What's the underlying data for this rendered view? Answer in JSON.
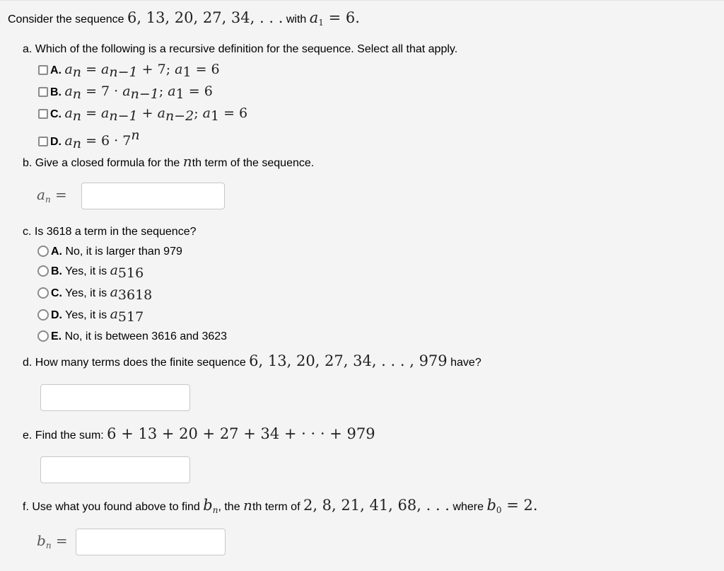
{
  "intro": {
    "prefix": "Consider the sequence ",
    "sequence": "6, 13, 20, 27, 34, . . .",
    "with_label": " with ",
    "first_term": {
      "var": "a",
      "sub": "1",
      "rest": " = 6."
    }
  },
  "part_a": {
    "question": "a. Which of the following is a recursive definition for the sequence. Select all that apply.",
    "options": [
      {
        "label": "A.",
        "formula": {
          "lhs": "a",
          "lhs_sub": "n",
          "p1": " = ",
          "v1": "a",
          "v1_sub": "n−1",
          "p2": " + 7; ",
          "v2": "a",
          "v2_sub": "1",
          "p3": " = 6"
        },
        "checked": false
      },
      {
        "label": "B.",
        "formula": {
          "lhs": "a",
          "lhs_sub": "n",
          "p1": " = 7 · ",
          "v1": "a",
          "v1_sub": "n−1",
          "p2": "; ",
          "v2": "a",
          "v2_sub": "1",
          "p3": " = 6"
        },
        "checked": false
      },
      {
        "label": "C.",
        "formula": {
          "lhs": "a",
          "lhs_sub": "n",
          "p1": " = ",
          "v1": "a",
          "v1_sub": "n−1",
          "p2": " + ",
          "v2": "a",
          "v2_sub": "n−2",
          "p3": "; ",
          "v3": "a",
          "v3_sub": "1",
          "p4": " = 6"
        },
        "checked": false
      },
      {
        "label": "D.",
        "formula": {
          "lhs": "a",
          "lhs_sub": "n",
          "p1": " = 6 · 7",
          "sup": "n"
        },
        "checked": false
      }
    ]
  },
  "part_b": {
    "question_pre": "b. Give a closed formula for the ",
    "question_var": "n",
    "question_post": "th term of the sequence.",
    "answer_lhs": "a",
    "answer_lhs_sub": "n",
    "answer_eq": " =",
    "answer_value": ""
  },
  "part_c": {
    "question": "c. Is 3618 a term in the sequence?",
    "options": [
      {
        "label": "A.",
        "text": " No, it is larger than 979",
        "var": "",
        "sub": "",
        "selected": false
      },
      {
        "label": "B.",
        "text": " Yes, it is ",
        "var": "a",
        "sub": "516",
        "selected": false
      },
      {
        "label": "C.",
        "text": " Yes, it is ",
        "var": "a",
        "sub": "3618",
        "selected": false
      },
      {
        "label": "D.",
        "text": " Yes, it is ",
        "var": "a",
        "sub": "517",
        "selected": false
      },
      {
        "label": "E.",
        "text": " No, it is between 3616 and 3623",
        "var": "",
        "sub": "",
        "selected": false
      }
    ]
  },
  "part_d": {
    "question_pre": "d. How many terms does the finite sequence ",
    "sequence": "6, 13, 20, 27, 34, . . . , 979",
    "question_post": " have?",
    "answer_value": ""
  },
  "part_e": {
    "question_pre": "e. Find the sum: ",
    "sum": "6 + 13 + 20 + 27 + 34 + · · · + 979",
    "answer_value": ""
  },
  "part_f": {
    "q1": "f. Use what you found above to find ",
    "b_var": "b",
    "b_sub": "n",
    "q2": ", the ",
    "n_var": "n",
    "q3": "th term of ",
    "sequence": "2, 8, 21, 41, 68, . . .",
    "q4": " where ",
    "b0_var": "b",
    "b0_sub": "0",
    "b0_rest": " = 2.",
    "answer_lhs": "b",
    "answer_lhs_sub": "n",
    "answer_eq": " =",
    "answer_value": ""
  }
}
